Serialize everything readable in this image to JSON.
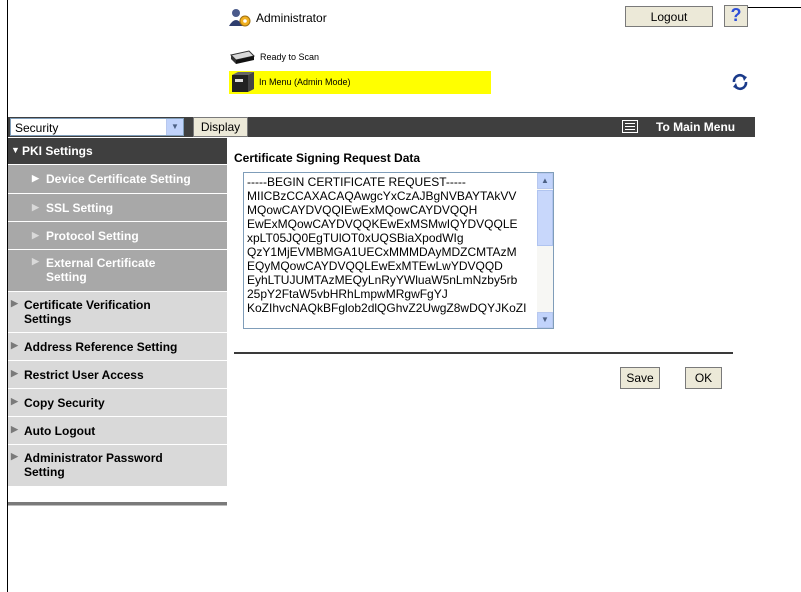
{
  "header": {
    "user": "Administrator",
    "logout_label": "Logout",
    "help_glyph": "?",
    "scan_status": "Ready to Scan",
    "menu_status": "In Menu (Admin Mode)",
    "admin_icon": "admin-user-icon",
    "scanner_icon": "scanner-icon",
    "mfp_icon": "mfp-device-icon",
    "refresh_icon": "refresh-icon",
    "menu_status_color": "#ffff00"
  },
  "topbar": {
    "category_select": "Security",
    "display_label": "Display",
    "main_menu_label": "To Main Menu",
    "bar_color": "#3f3f3f"
  },
  "sidebar": {
    "items": [
      {
        "label": "PKI Settings"
      },
      {
        "label": "Device Certificate Setting"
      },
      {
        "label": "SSL Setting"
      },
      {
        "label": "Protocol Setting"
      },
      {
        "label": "External Certificate Setting"
      },
      {
        "label": "Certificate Verification Settings"
      },
      {
        "label": "Address Reference Setting"
      },
      {
        "label": "Restrict User Access"
      },
      {
        "label": "Copy Security"
      },
      {
        "label": "Auto Logout"
      },
      {
        "label": "Administrator Password Setting"
      }
    ]
  },
  "content": {
    "title": "Certificate Signing Request Data",
    "csr_text": "-----BEGIN CERTIFICATE REQUEST-----\nMIICBzCCAXACAQAwgcYxCzAJBgNVBAYTAkVV\nMQowCAYDVQQIEwExMQowCAYDVQQH\nEwExMQowCAYDVQQKEwExMSMwIQYDVQQLE\nxpLT05JQ0EgTUlOT0xUQSBiaXpodWIg\nQzY1MjEVMBMGA1UECxMMMDAyMDZCMTAzM\nEQyMQowCAYDVQQLEwExMTEwLwYDVQQD\nEyhLTUJUMTAzMEQyLnRyYWluaW5nLmNzby5rb\n25pY2FtaW5vbHRhLmpwMRgwFgYJ\nKoZIhvcNAQkBFglob2dlQGhvZ2UwgZ8wDQYJKoZI",
    "save_label": "Save",
    "ok_label": "OK"
  }
}
